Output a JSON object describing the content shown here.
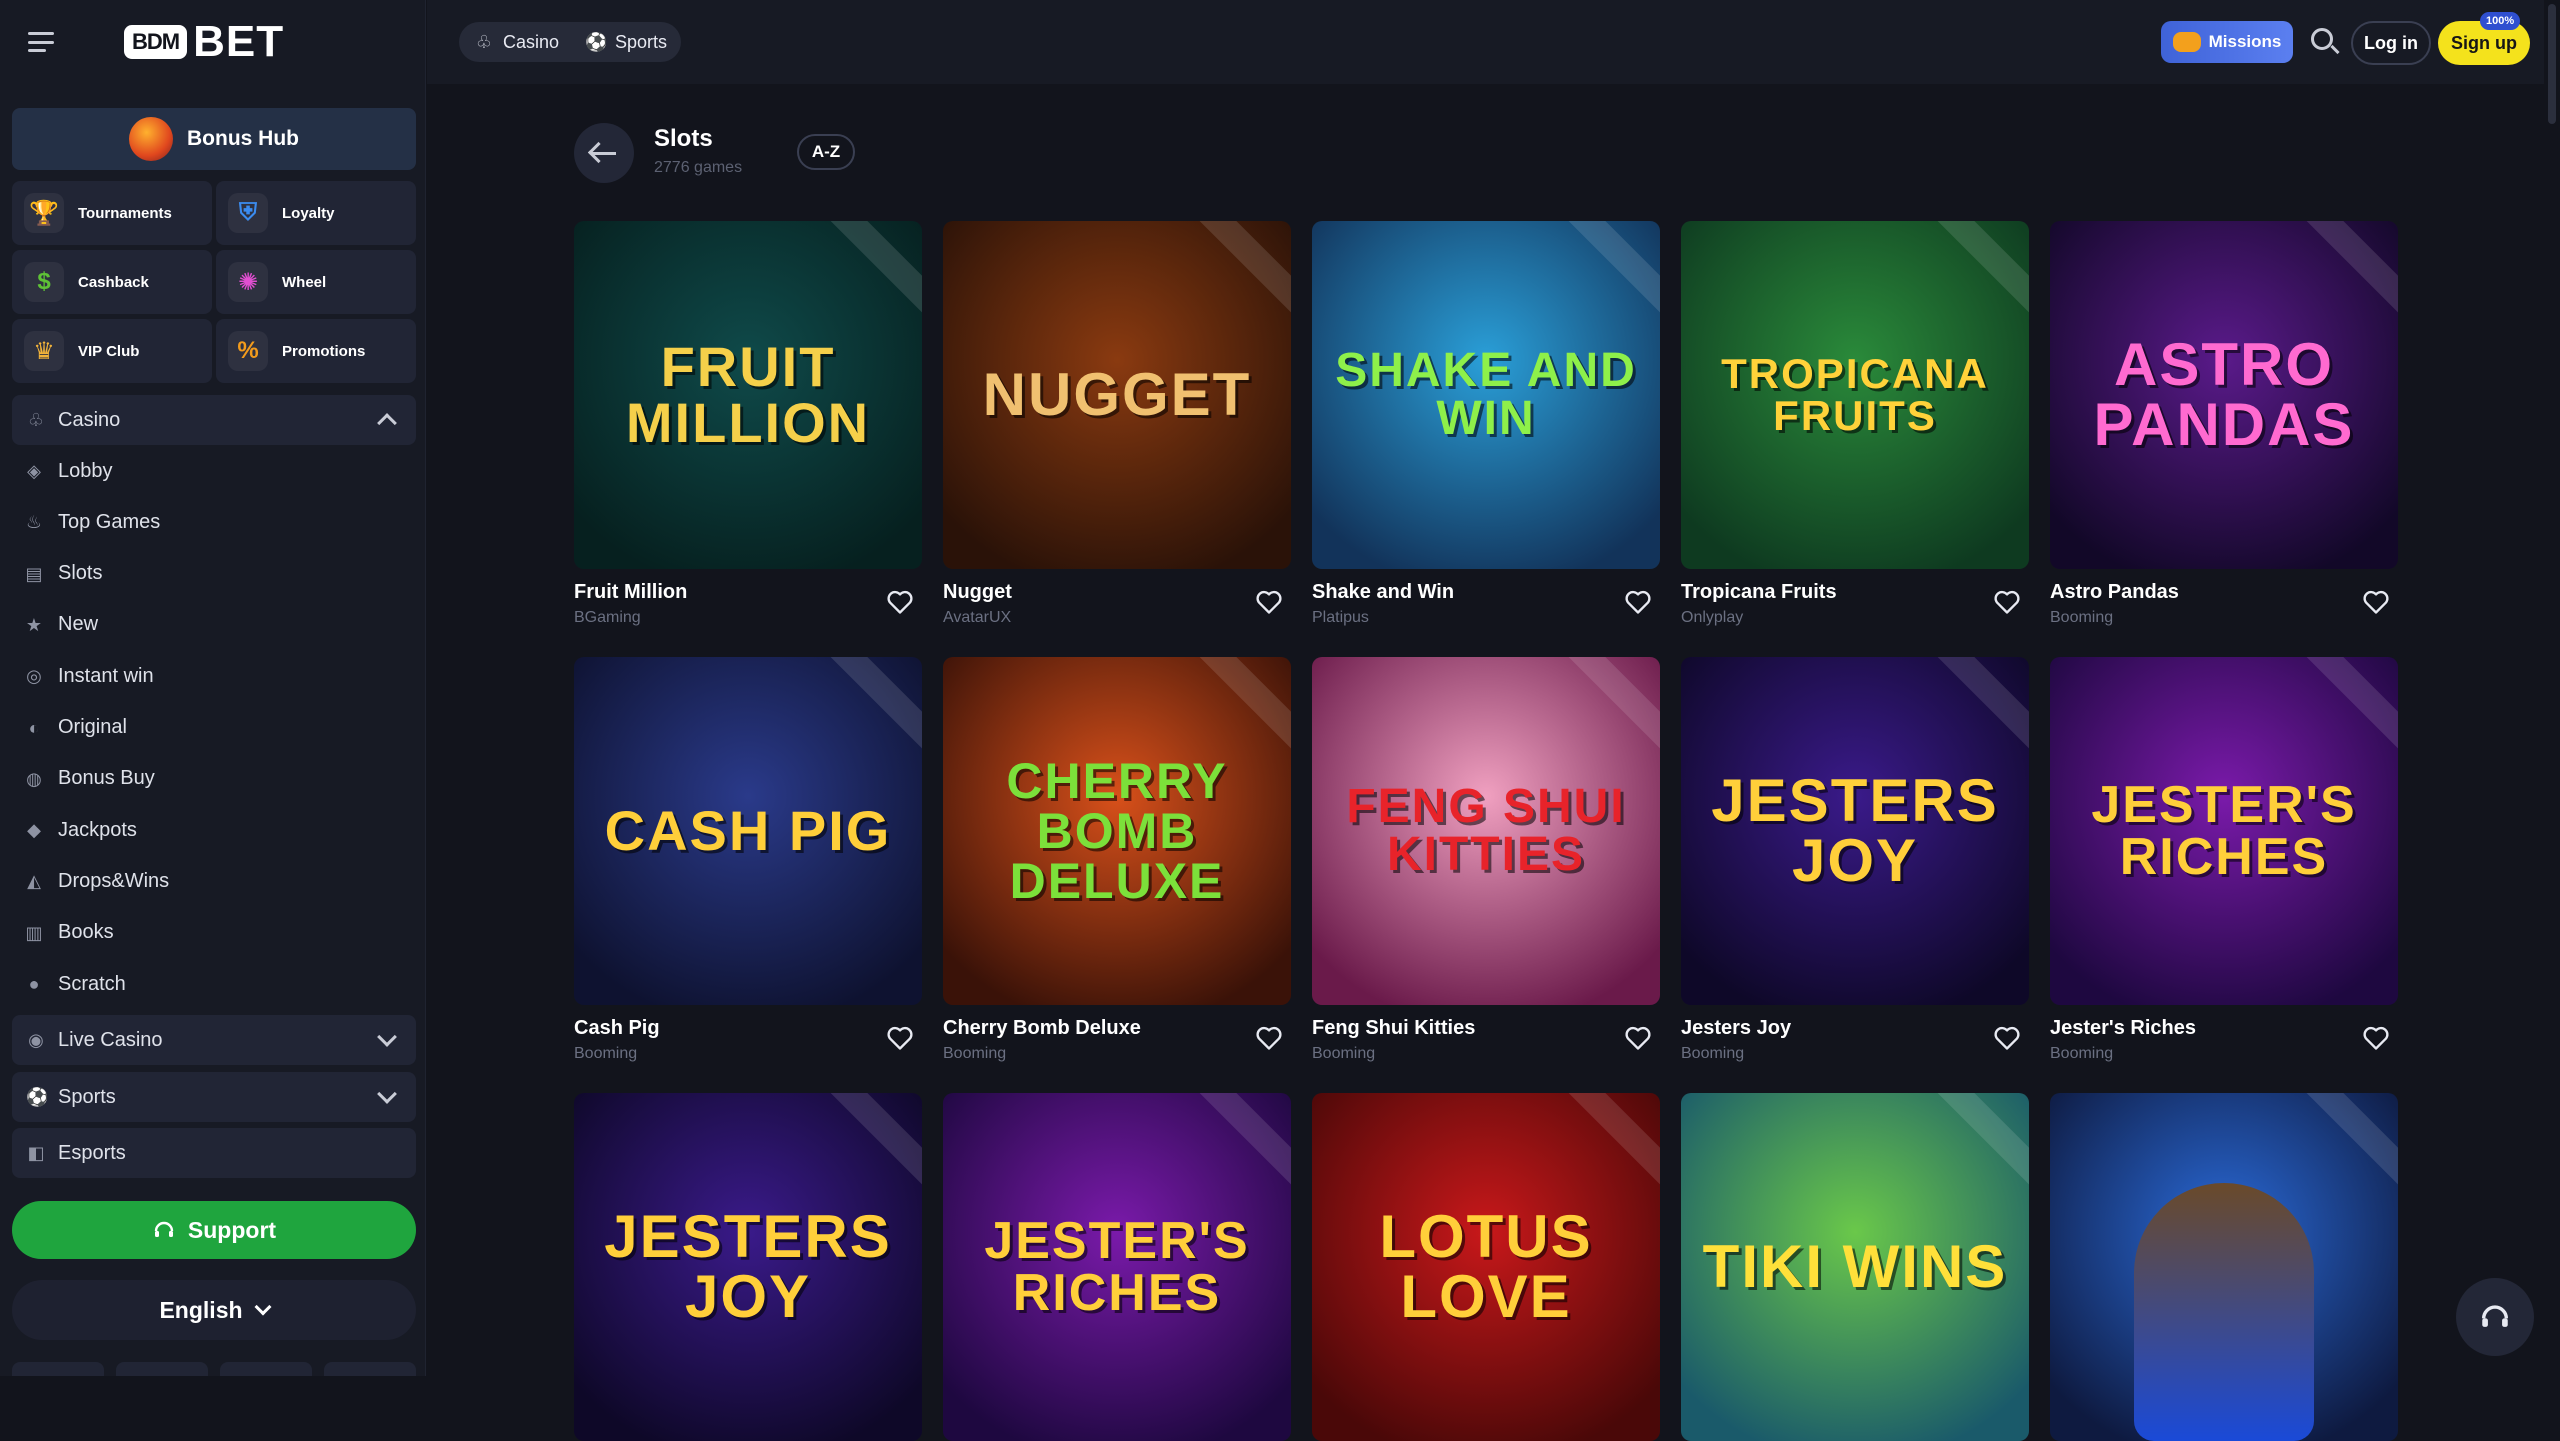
{
  "sidebar": {
    "logo": {
      "box": "BDM",
      "text": "BET"
    },
    "bonus_hub": "Bonus Hub",
    "tiles": [
      {
        "label": "Tournaments",
        "icon": "trophy-icon",
        "glyph": "🏆",
        "color": "#f2b33a"
      },
      {
        "label": "Loyalty",
        "icon": "shield-icon",
        "glyph": "⛨",
        "color": "#3b8cf0"
      },
      {
        "label": "Cashback",
        "icon": "cashback-icon",
        "glyph": "$",
        "color": "#5ec236"
      },
      {
        "label": "Wheel",
        "icon": "wheel-icon",
        "glyph": "✺",
        "color": "#e14fd1"
      },
      {
        "label": "VIP Club",
        "icon": "crown-icon",
        "glyph": "♛",
        "color": "#f2b33a"
      },
      {
        "label": "Promotions",
        "icon": "percent-icon",
        "glyph": "%",
        "color": "#f29b1c"
      }
    ],
    "casino_group": "Casino",
    "casino_items": [
      {
        "label": "Lobby",
        "icon": "lobby-icon",
        "glyph": "◈"
      },
      {
        "label": "Top Games",
        "icon": "flame-icon",
        "glyph": "♨"
      },
      {
        "label": "Slots",
        "icon": "slots-icon",
        "glyph": "▤"
      },
      {
        "label": "New",
        "icon": "star-icon",
        "glyph": "★"
      },
      {
        "label": "Instant win",
        "icon": "instant-win-icon",
        "glyph": "◎"
      },
      {
        "label": "Original",
        "icon": "original-icon",
        "glyph": "◐"
      },
      {
        "label": "Bonus Buy",
        "icon": "bonus-buy-icon",
        "glyph": "◍"
      },
      {
        "label": "Jackpots",
        "icon": "jackpot-icon",
        "glyph": "◆"
      },
      {
        "label": "Drops&Wins",
        "icon": "drops-icon",
        "glyph": "◭"
      },
      {
        "label": "Books",
        "icon": "book-icon",
        "glyph": "▥"
      },
      {
        "label": "Scratch",
        "icon": "scratch-icon",
        "glyph": "●"
      }
    ],
    "live_casino": "Live Casino",
    "sports": "Sports",
    "esports": "Esports",
    "support": "Support",
    "language": "English"
  },
  "topbar": {
    "casino_tab": "Casino",
    "sports_tab": "Sports",
    "missions": "Missions",
    "login": "Log in",
    "signup": "Sign up",
    "signup_badge": "100%"
  },
  "main": {
    "title": "Slots",
    "count": "2776 games",
    "sort": "A-Z"
  },
  "games": [
    {
      "name": "Fruit Million",
      "provider": "BGaming",
      "art": "FRUIT MILLION",
      "bg": "#0f4a4a",
      "bg2": "#06201f",
      "fg": "#f5d04a",
      "fs": 56
    },
    {
      "name": "Nugget",
      "provider": "AvatarUX",
      "art": "NUGGET",
      "bg": "#8a3a10",
      "bg2": "#2a1208",
      "fg": "#f0c070",
      "fs": 60
    },
    {
      "name": "Shake and Win",
      "provider": "Platipus",
      "art": "SHAKE AND WIN",
      "bg": "#2a9fd8",
      "bg2": "#12335a",
      "fg": "#8ef04a",
      "fs": 48
    },
    {
      "name": "Tropicana Fruits",
      "provider": "Onlyplay",
      "art": "TROPICANA FRUITS",
      "bg": "#2a8a3a",
      "bg2": "#0e3a20",
      "fg": "#ffd23a",
      "fs": 42
    },
    {
      "name": "Astro Pandas",
      "provider": "Booming",
      "art": "ASTRO PANDAS",
      "bg": "#5a1a8a",
      "bg2": "#120828",
      "fg": "#ff6ad0",
      "fs": 60
    },
    {
      "name": "Cash Pig",
      "provider": "Booming",
      "art": "CASH PIG",
      "bg": "#2a3a8a",
      "bg2": "#0e1230",
      "fg": "#ffcf3a",
      "fs": 56
    },
    {
      "name": "Cherry Bomb Deluxe",
      "provider": "Booming",
      "art": "CHERRY BOMB DELUXE",
      "bg": "#d8501a",
      "bg2": "#3a1208",
      "fg": "#7ce03a",
      "fs": 50
    },
    {
      "name": "Feng Shui Kitties",
      "provider": "Booming",
      "art": "FENG SHUI KITTIES",
      "bg": "#f0a0c0",
      "bg2": "#6a1a4a",
      "fg": "#e8232a",
      "fs": 48
    },
    {
      "name": "Jesters Joy",
      "provider": "Booming",
      "art": "JESTERS JOY",
      "bg": "#3a1a8a",
      "bg2": "#0e0828",
      "fg": "#ffcf3a",
      "fs": 60
    },
    {
      "name": "Jester's Riches",
      "provider": "Booming",
      "art": "JESTER'S RICHES",
      "bg": "#7a1aaa",
      "bg2": "#1e0840",
      "fg": "#ffcf3a",
      "fs": 52
    },
    {
      "name": "",
      "provider": "",
      "art": "JESTERS JOY",
      "bg": "#3a1a8a",
      "bg2": "#0e0828",
      "fg": "#ffcf3a",
      "fs": 60
    },
    {
      "name": "",
      "provider": "",
      "art": "JESTER'S RICHES",
      "bg": "#7a1aaa",
      "bg2": "#1e0840",
      "fg": "#ffcf3a",
      "fs": 52
    },
    {
      "name": "",
      "provider": "",
      "art": "LOTUS LOVE",
      "bg": "#c8181a",
      "bg2": "#4a0808",
      "fg": "#ffcf3a",
      "fs": 60
    },
    {
      "name": "",
      "provider": "",
      "art": "TIKI WINS",
      "bg": "#6ac84a",
      "bg2": "#1a5a6a",
      "fg": "#ffe03a",
      "fs": 60
    },
    {
      "name": "",
      "provider": "",
      "art": "",
      "bg": "#2a6ad8",
      "bg2": "#0e1a40",
      "fg": "#ffffff",
      "fs": 40
    }
  ]
}
